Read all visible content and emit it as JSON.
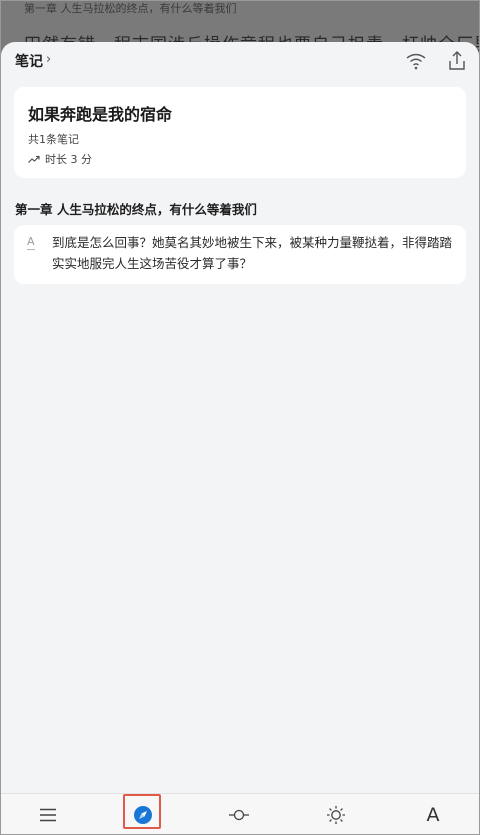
{
  "background": {
    "chapter_line": "第一章 人生马拉松的终点，有什么等着我们",
    "text_line": "田然有错，程志国涉丘操作竟程也要自己担责，杆帅全厂里开始扯"
  },
  "sheet": {
    "title": "笔记",
    "chevron": "›",
    "icons": [
      "listen-icon",
      "share-icon"
    ]
  },
  "book": {
    "title": "如果奔跑是我的宿命",
    "note_count": "共1条笔记",
    "duration": "时长 3 分"
  },
  "chapter": {
    "title": "第一章 人生马拉松的终点，有什么等着我们"
  },
  "note": {
    "mark": "A",
    "text": "到底是怎么回事？她莫名其妙地被生下来，被某种力量鞭挞着，非得踏踏实实地服完人生这场苦役才算了事？"
  },
  "toolbar": {
    "items": [
      "menu-icon",
      "compass-icon",
      "progress-icon",
      "brightness-icon",
      "font-icon"
    ],
    "font_label": "A",
    "highlight_color": "#e05a4a"
  }
}
